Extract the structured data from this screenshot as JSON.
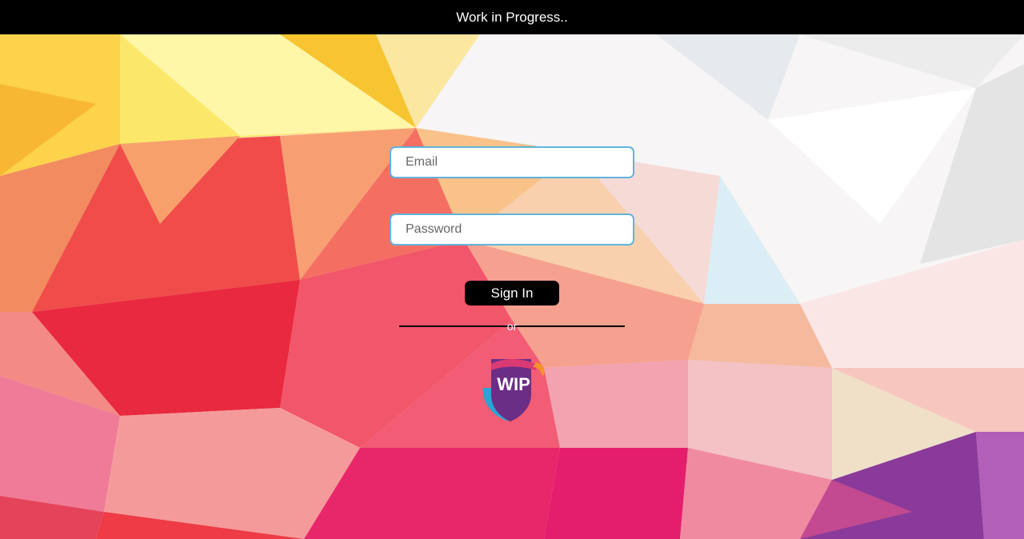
{
  "header": {
    "title": "Work in Progress.."
  },
  "login": {
    "email_placeholder": "Email",
    "password_placeholder": "Password",
    "signin_label": "Sign In",
    "divider_text": "or"
  },
  "logo": {
    "text": "WIP",
    "icon": "wip-shield-icon"
  },
  "colors": {
    "topbar": "#000000",
    "field_border": "#5fb4e0",
    "button": "#000000"
  }
}
